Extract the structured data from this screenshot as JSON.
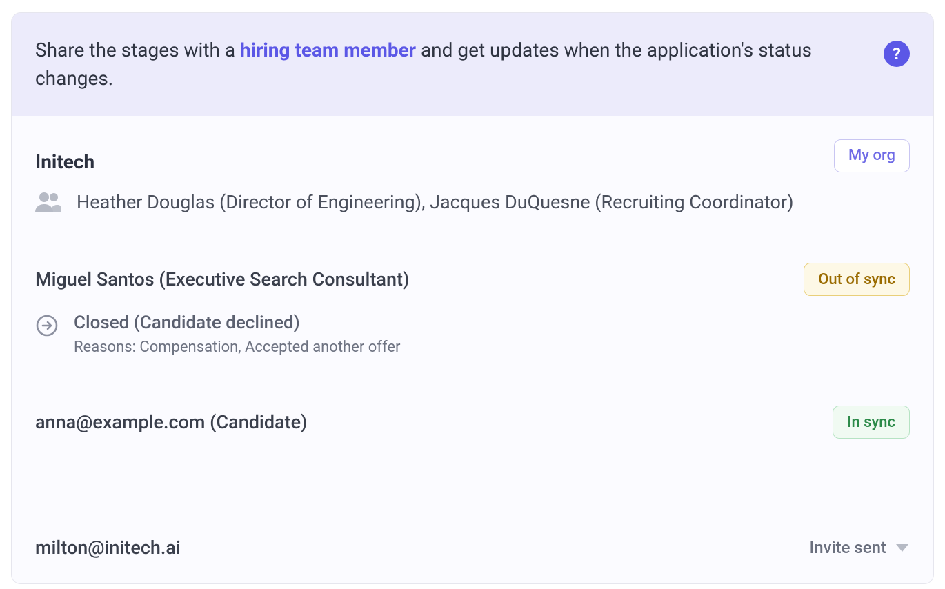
{
  "banner": {
    "prefix": "Share the stages with a ",
    "link_text": "hiring team member",
    "suffix": " and get updates when the application's status changes.",
    "help_glyph": "?"
  },
  "org": {
    "name": "Initech",
    "my_org_badge": "My org",
    "people_line": "Heather Douglas (Director of Engineering), Jacques DuQuesne (Recruiting Coordinator)"
  },
  "participants": [
    {
      "title": "Miguel Santos (Executive Search Consultant)",
      "sync_state": "Out of sync",
      "status_main": "Closed (Candidate declined)",
      "status_reasons": "Reasons: Compensation, Accepted another offer"
    },
    {
      "title": "anna@example.com (Candidate)",
      "sync_state": "In sync"
    }
  ],
  "pending": {
    "email": "milton@initech.ai",
    "status": "Invite sent"
  }
}
